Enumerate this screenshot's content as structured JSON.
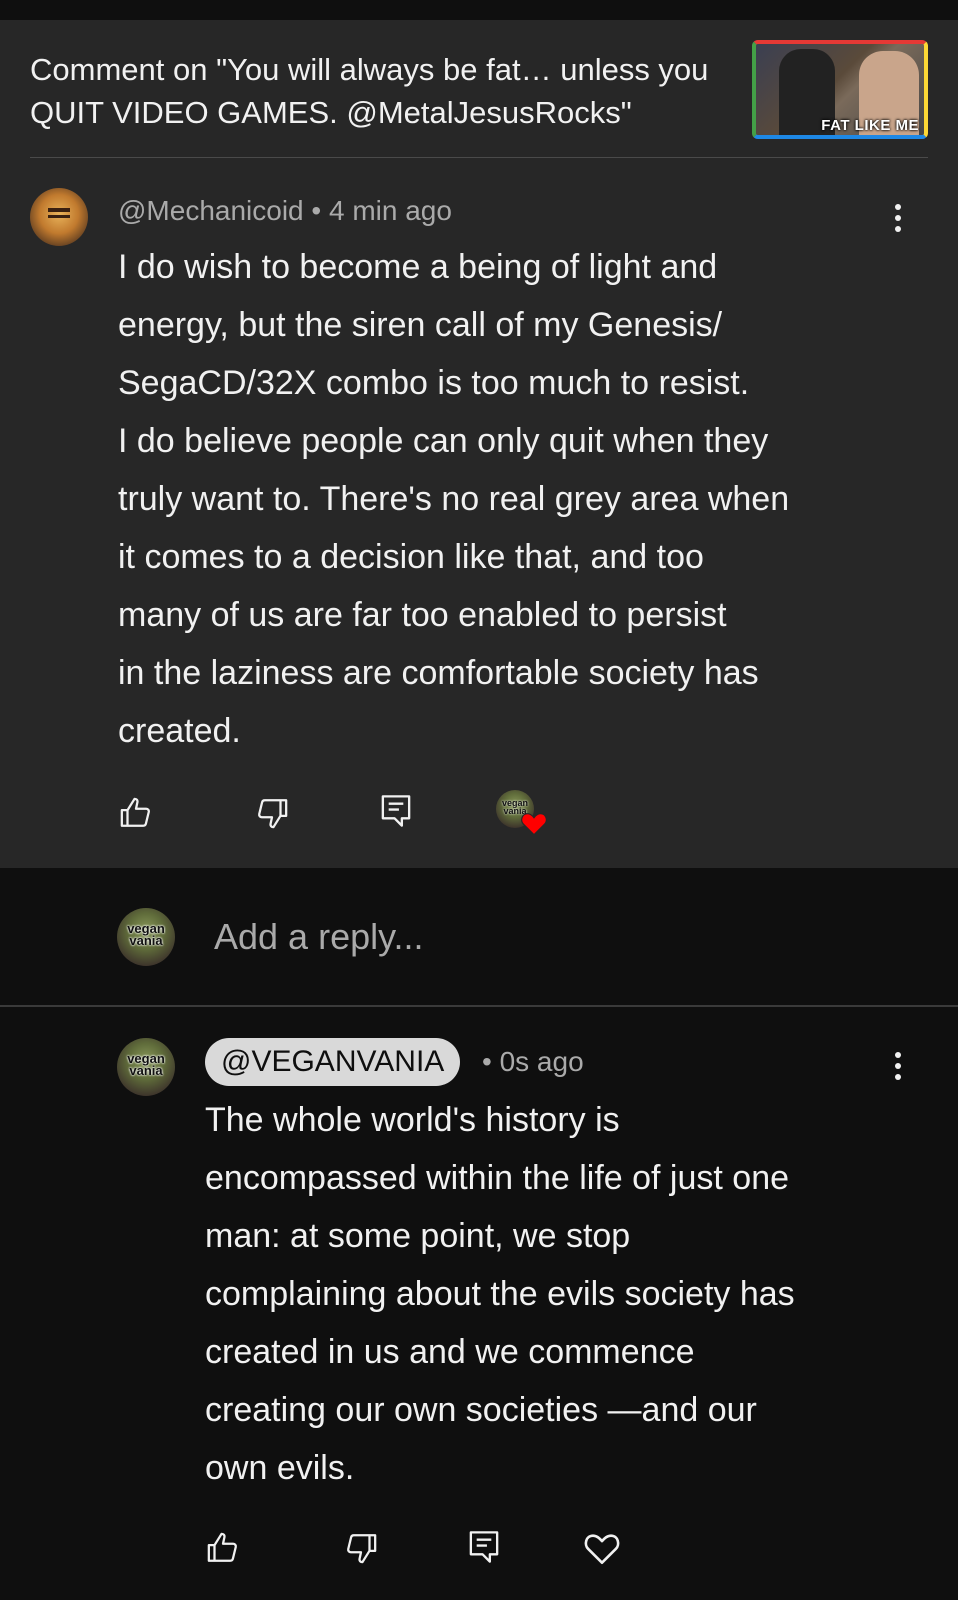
{
  "header": {
    "title": "Comment on \"You will always be fat… unless you QUIT VIDEO GAMES. @MetalJesusRocks\"",
    "thumbnail_caption": "FAT LIKE ME"
  },
  "comment": {
    "author": "@Mechanicoid",
    "time": "• 4 min ago",
    "text": "I do wish to become a being of light and\nenergy, but the siren call of my Genesis/\nSegaCD/32X combo is too much to resist.\nI do believe people can only quit when they\ntruly want to. There's no real grey area when\nit comes to a decision like that, and too\nmany of us are far too enabled to persist\nin the laziness are comfortable society has\ncreated.",
    "icons": [
      "thumb-up",
      "thumb-down",
      "reply",
      "creator-heart"
    ]
  },
  "reply_box": {
    "placeholder": "Add a reply...",
    "avatar_text": "vegan vania"
  },
  "reply": {
    "author": "@VEGANVANIA",
    "time": "• 0s ago",
    "avatar_text": "vegan vania",
    "text": "The whole world's history is\nencompassed within the life of just one\nman: at some point, we stop\ncomplaining about the evils society has\ncreated in us and we commence\ncreating our own societies —and our\nown evils.",
    "icons": [
      "thumb-up",
      "thumb-down",
      "reply",
      "heart"
    ]
  },
  "colors": {
    "background": "#0f0f0f",
    "card": "#272727",
    "text": "#f1f1f1",
    "secondary_text": "#aaaaaa",
    "heart": "#ff0000"
  }
}
